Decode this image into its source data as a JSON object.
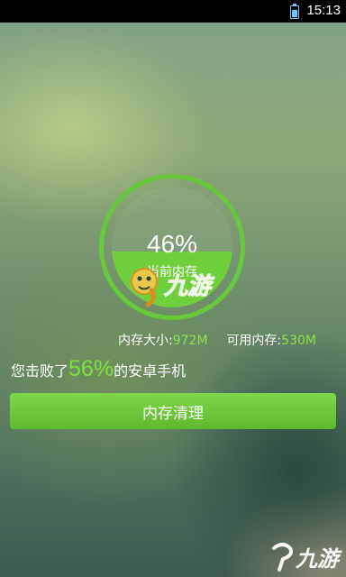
{
  "status_bar": {
    "time": "15:13",
    "battery_icon": "battery-charging-icon"
  },
  "gauge": {
    "percent_text": "46%",
    "percent_value": 0.46,
    "label": "当前内存",
    "ring_color": "#66c83a",
    "fill_color": "#6fcf3c"
  },
  "memory": {
    "total_label": "内存大小:",
    "total_value": "972M",
    "available_label": "可用内存:",
    "available_value": "530M"
  },
  "beat": {
    "prefix": "您击败了",
    "percent": "56%",
    "suffix": "的安卓手机"
  },
  "clean_button": {
    "label": "内存清理"
  },
  "watermark": {
    "text": "九游"
  },
  "accent_color": "#7ee03a"
}
